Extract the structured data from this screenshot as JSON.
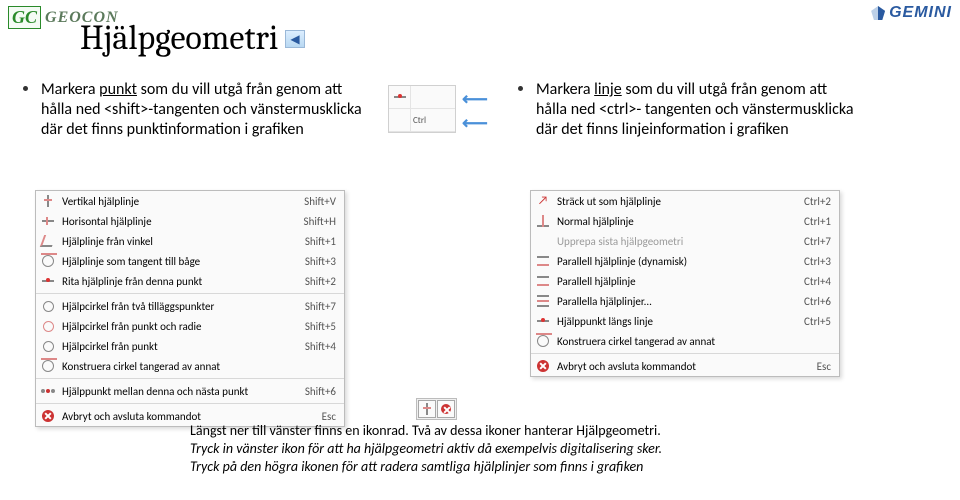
{
  "branding": {
    "left_mark": "GC",
    "left_text": "GEOCON",
    "right_text": "GEMINI"
  },
  "title": "Hjälpgeometri",
  "back_glyph": "◀",
  "left_bullet": {
    "pre": "Markera ",
    "underlined": "punkt",
    "post": " som du vill utgå från genom att hålla ned <shift>-tangenten och vänstermusklicka där det finns punktinformation i grafiken"
  },
  "right_bullet": {
    "pre": "Markera ",
    "underlined": "linje",
    "post": " som du vill utgå från genom att hålla ned <ctrl>- tangenten och vänstermusklicka där det finns linjeinformation i grafiken"
  },
  "ctrl_snippet": {
    "r1": "Ctrl"
  },
  "left_menu": [
    {
      "icon": "v",
      "label": "Vertikal hjälplinje",
      "sc": "Shift+V"
    },
    {
      "icon": "h",
      "label": "Horisontal hjälplinje",
      "sc": "Shift+H"
    },
    {
      "icon": "ang",
      "label": "Hjälplinje från vinkel",
      "sc": "Shift+1"
    },
    {
      "icon": "tan",
      "label": "Hjälplinje som tangent till båge",
      "sc": "Shift+3"
    },
    {
      "icon": "pt",
      "label": "Rita hjälplinje från denna punkt",
      "sc": "Shift+2"
    },
    {
      "sep": true
    },
    {
      "icon": "circ",
      "label": "Hjälpcirkel från två tilläggspunkter",
      "sc": "Shift+7"
    },
    {
      "icon": "circ2",
      "label": "Hjälpcirkel från punkt och radie",
      "sc": "Shift+5"
    },
    {
      "icon": "circ",
      "label": "Hjälpcirkel från punkt",
      "sc": "Shift+4"
    },
    {
      "icon": "tan",
      "label": "Konstruera cirkel tangerad av annat",
      "sc": ""
    },
    {
      "sep": true
    },
    {
      "icon": "dot",
      "label": "Hjälppunkt mellan denna och nästa punkt",
      "sc": "Shift+6"
    },
    {
      "sep": true
    },
    {
      "icon": "x",
      "label": "Avbryt och avsluta kommandot",
      "sc": "Esc"
    }
  ],
  "right_menu": [
    {
      "icon": "arr",
      "label": "Sträck ut som hjälplinje",
      "sc": "Ctrl+2"
    },
    {
      "icon": "norm",
      "label": "Normal hjälplinje",
      "sc": "Ctrl+1"
    },
    {
      "icon": "",
      "label": "Upprepa sista hjälpgeometri",
      "sc": "Ctrl+7",
      "disabled": true
    },
    {
      "icon": "par",
      "label": "Parallell hjälplinje (dynamisk)",
      "sc": "Ctrl+3"
    },
    {
      "icon": "par",
      "label": "Parallell hjälplinje",
      "sc": "Ctrl+4"
    },
    {
      "icon": "par3",
      "label": "Parallella hjälplinjer...",
      "sc": "Ctrl+6"
    },
    {
      "icon": "pt",
      "label": "Hjälppunkt längs linje",
      "sc": "Ctrl+5"
    },
    {
      "icon": "tan",
      "label": "Konstruera cirkel tangerad av annat",
      "sc": ""
    },
    {
      "sep": true
    },
    {
      "icon": "x",
      "label": "Avbryt och avsluta kommandot",
      "sc": "Esc"
    }
  ],
  "footer": {
    "line1": "Längst ner till vänster finns en ikonrad. Två av dessa ikoner hanterar Hjälpgeometri.",
    "line2": "Tryck in vänster ikon för att ha hjälpgeometri aktiv då exempelvis digitalisering sker.",
    "line3": "Tryck på den högra ikonen för att radera samtliga hjälplinjer som finns i grafiken"
  }
}
